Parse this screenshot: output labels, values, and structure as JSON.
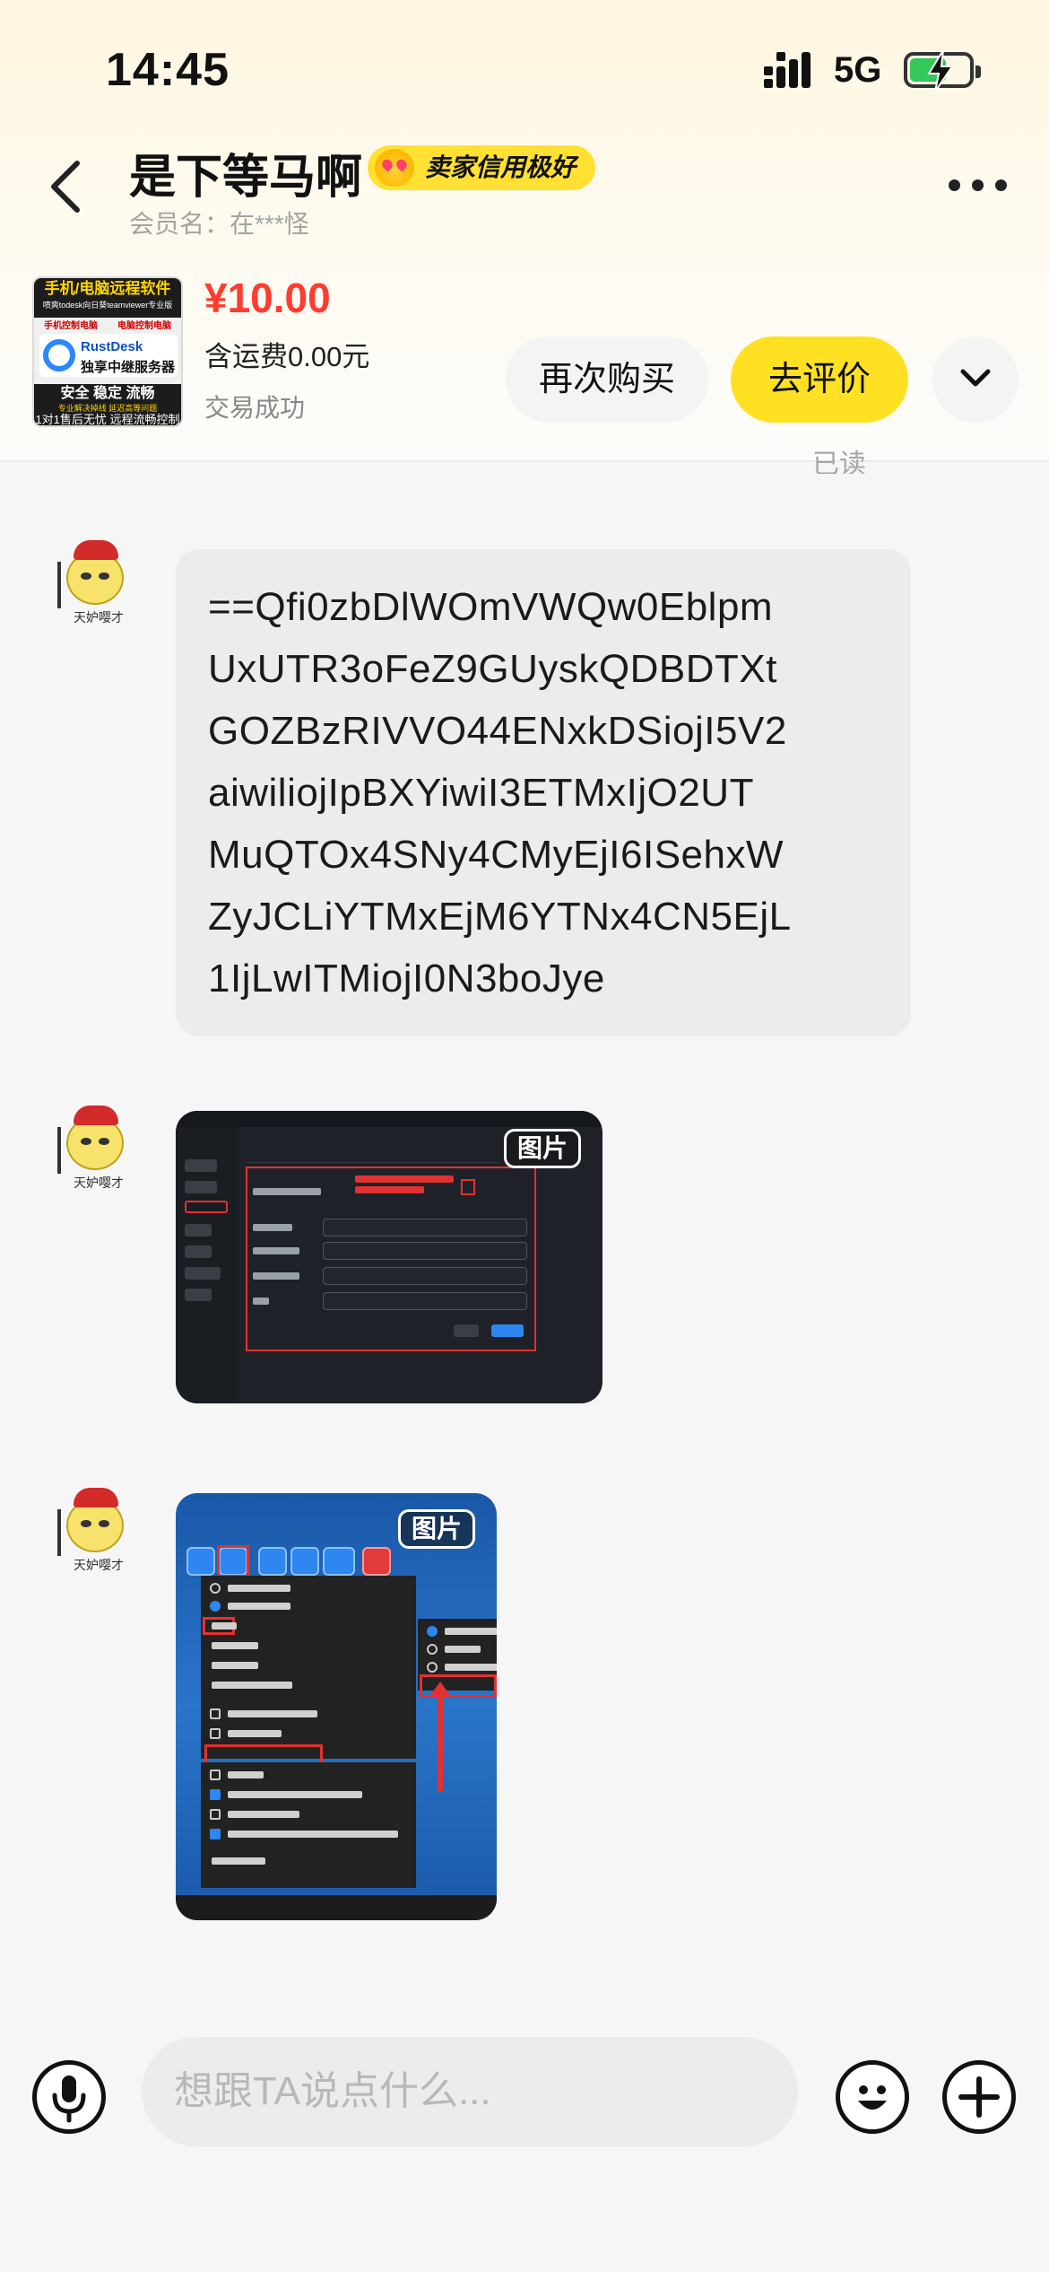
{
  "status_bar": {
    "time": "14:45",
    "network": "5G",
    "battery_level": 0.6,
    "charging": true
  },
  "header": {
    "seller_name": "是下等马啊",
    "credit_badge": "卖家信用极好",
    "member_line": "会员名：在***怪",
    "back_icon": "chevron-left-icon",
    "more_icon": "more-dots-icon"
  },
  "order": {
    "thumbnail": {
      "top_line": "手机/电脑远程软件",
      "top_small": "喷爽todesk向日葵teamviewer专业版",
      "sub_left": "手机控制电脑",
      "sub_right": "电脑控制电脑",
      "brand": "RustDesk",
      "brand_sub": "独享中继服务器",
      "features": "安全  稳定  流畅",
      "features_small": "专业解决掉线  延迟高等问题",
      "footer": "1对1售后无忧 远程流畅控制"
    },
    "price": "¥10.00",
    "shipping": "含运费0.00元",
    "status": "交易成功",
    "rebuy_label": "再次购买",
    "review_label": "去评价",
    "expand_icon": "chevron-down-icon"
  },
  "chat": {
    "read_receipt": "已读",
    "messages": [
      {
        "type": "text",
        "avatar_caption": "天妒嘤才",
        "lines": [
          "==Qfi0zbDlWOmVWQw0Eblpm",
          "UxUTR3oFeZ9GUyskQDBDTXt",
          "GOZBzRIVVO44ENxkDSiojI5V2",
          "aiwiliojIpBXYiwiI3ETMxIjO2UT",
          "MuQTOx4SNy4CMyEjI6ISehxW",
          "ZyJCLiYTMxEjM6YTNx4CN5EjL",
          "1IjLwITMiojI0N3boJye"
        ]
      },
      {
        "type": "image",
        "avatar_caption": "天妒嘤才",
        "badge": "图片"
      },
      {
        "type": "image",
        "avatar_caption": "天妒嘤才",
        "badge": "图片"
      }
    ]
  },
  "input_bar": {
    "placeholder": "想跟TA说点什么...",
    "mic_icon": "microphone-icon",
    "emoji_icon": "emoji-icon",
    "plus_icon": "plus-icon"
  }
}
